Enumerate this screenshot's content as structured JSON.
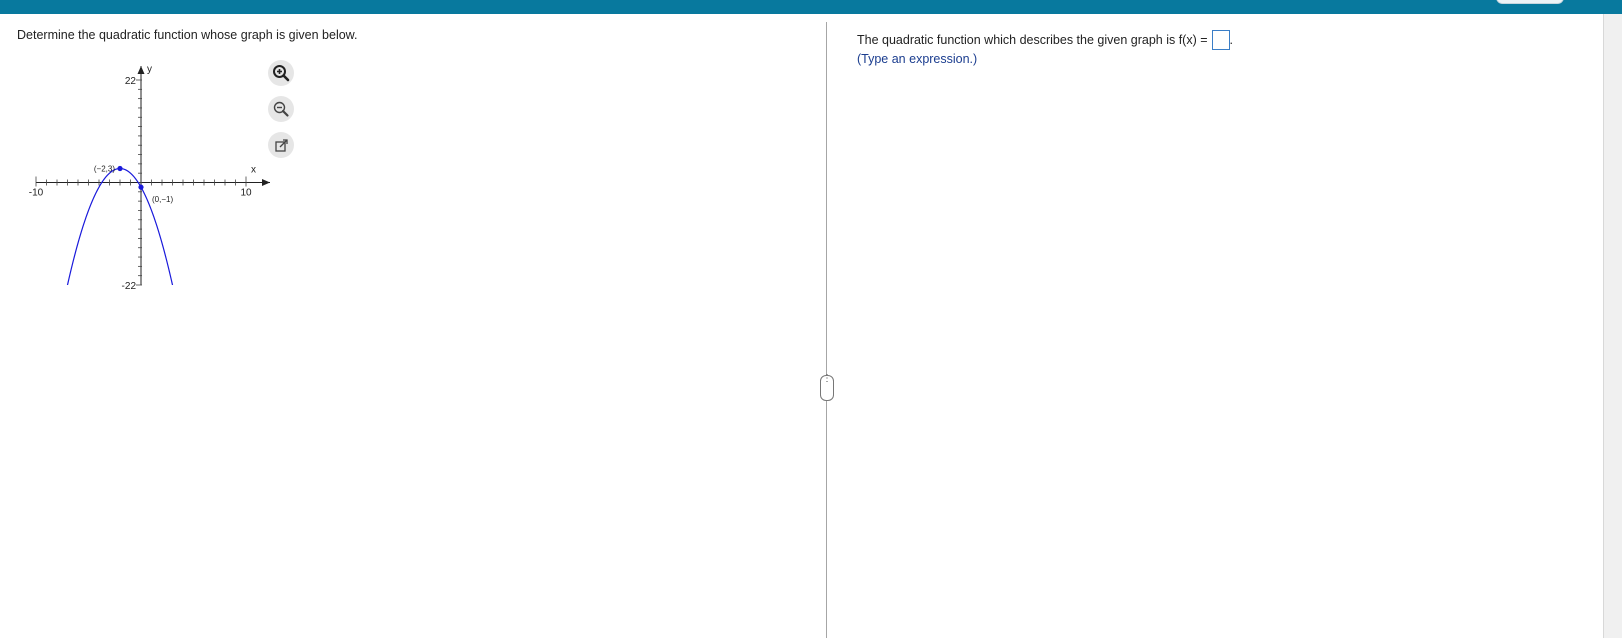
{
  "question": {
    "prompt": "Determine the quadratic function whose graph is given below."
  },
  "graph_tools": {
    "zoom_in_icon": "zoom-in-icon",
    "zoom_out_icon": "zoom-out-icon",
    "popout_icon": "external-link-icon"
  },
  "chart_data": {
    "type": "line",
    "title": "",
    "xlabel": "x",
    "ylabel": "y",
    "xlim": [
      -10,
      10
    ],
    "ylim": [
      -22,
      22
    ],
    "x_tick_labels": [
      "-10",
      "10"
    ],
    "y_tick_labels": [
      "22",
      "-22"
    ],
    "series": [
      {
        "color": "#1a1adb",
        "x": [
          -10,
          -9,
          -8,
          -7,
          -6,
          -5,
          -4,
          -3,
          -2,
          -1,
          0,
          1,
          2,
          3
        ],
        "y": [
          -61,
          -46,
          -33,
          -22,
          -13,
          -6,
          -1,
          2,
          3,
          2,
          -1,
          -6,
          -13,
          -22
        ]
      }
    ],
    "points": [
      {
        "x": -2,
        "y": 3,
        "label": "(−2,3)"
      },
      {
        "x": 0,
        "y": -1,
        "label": "(0,−1)"
      }
    ]
  },
  "answer": {
    "prefix": "The quadratic function which describes the given graph is f(x) =",
    "suffix": ".",
    "hint": "(Type an expression.)"
  }
}
